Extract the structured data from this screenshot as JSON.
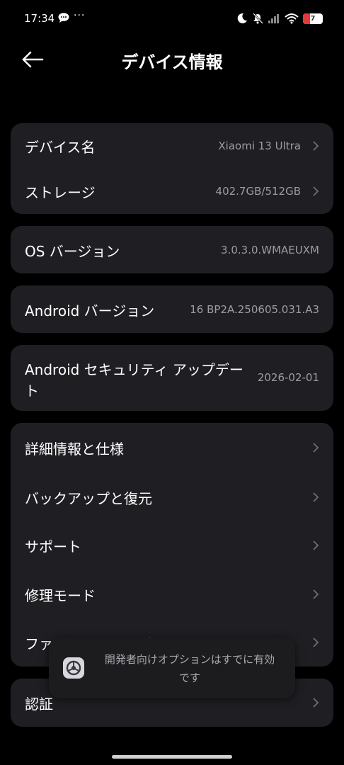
{
  "status_bar": {
    "time": "17:34",
    "more": "···",
    "battery": "7",
    "battery_color": "#e23b3b"
  },
  "header": {
    "title": "デバイス情報",
    "back_icon": "arrow-left-icon"
  },
  "card1": [
    {
      "label": "デバイス名",
      "value": "Xiaomi 13 Ultra"
    },
    {
      "label": "ストレージ",
      "value": "402.7GB/512GB"
    }
  ],
  "os_version": {
    "label": "OS バージョン",
    "value": "3.0.3.0.WMAEUXM"
  },
  "android_version": {
    "label": "Android バージョン",
    "value": "16 BP2A.250605.031.A3"
  },
  "security": {
    "label_line1": "Android セキュリティ アップデー",
    "label_line2": "ト",
    "value": "2026-02-01"
  },
  "menu": [
    {
      "label": "詳細情報と仕様"
    },
    {
      "label": "バックアップと復元"
    },
    {
      "label": "サポート"
    },
    {
      "label": "修理モード"
    },
    {
      "label": "ファームウェアのバージョン"
    }
  ],
  "certification": {
    "label": "認証"
  },
  "toast": {
    "line1": "開発者向けオプションはすでに有効",
    "line2": "です",
    "icon": "settings-gear-icon"
  },
  "colors": {
    "background": "#000000",
    "card": "#1f1f23",
    "secondary_text": "#9c9ca2"
  }
}
